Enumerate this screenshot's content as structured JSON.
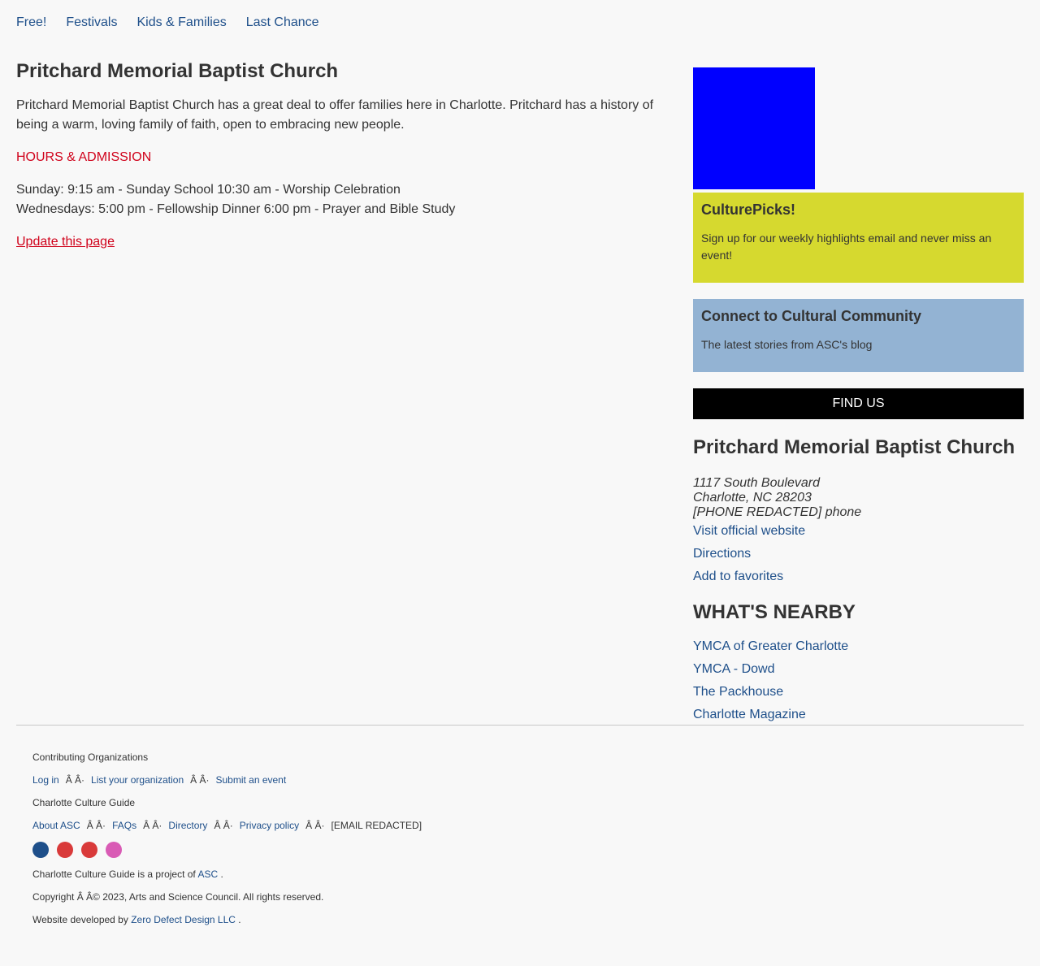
{
  "nav": {
    "items": [
      "Free!",
      "Festivals",
      "Kids & Families",
      "Last Chance"
    ]
  },
  "main": {
    "title": "Pritchard Memorial Baptist Church",
    "intro": "Pritchard Memorial Baptist Church has a great deal to offer families here in Charlotte. Pritchard has a history of being a warm, loving family of faith, open to embracing new people.",
    "hours_title": "HOURS & ADMISSION",
    "hours_lines": [
      "Sunday: 9:15 am - Sunday School 10:30 am - Worship Celebration",
      "Wednesdays: 5:00 pm - Fellowship Dinner 6:00 pm - Prayer and Bible Study"
    ],
    "update_link": "Update this page"
  },
  "sidebar": {
    "culturepicks": {
      "title": "CulturePicks!",
      "text": "Sign up for our weekly highlights email and never miss an event!"
    },
    "connect": {
      "title": "Connect to Cultural Community",
      "text": "The latest stories from ASC's blog"
    },
    "findus_label": "FIND US",
    "venue_title": "Pritchard Memorial Baptist Church",
    "address_lines": [
      "1117 South Boulevard",
      "Charlotte, NC 28203",
      "[PHONE REDACTED] phone"
    ],
    "links": [
      "Visit official website",
      "Directions",
      "Add to favorites"
    ],
    "nearby_title": "WHAT'S NEARBY",
    "nearby": [
      "YMCA of Greater Charlotte",
      "YMCA - Dowd",
      "The Packhouse",
      "Charlotte Magazine"
    ]
  },
  "footer": {
    "contributing": "Contributing Organizations",
    "org_links": [
      "Log in",
      "List your organization",
      "Submit an event"
    ],
    "separator": "Â   Â·",
    "guide_title": "Charlotte Culture Guide",
    "guide_links": [
      "About ASC",
      "FAQs",
      "Directory",
      "Privacy policy"
    ],
    "email": "[EMAIL REDACTED]",
    "social_colors": [
      "#1e4f8a",
      "#d93a3a",
      "#d93a3a",
      "#d95bb5"
    ],
    "project_text": "Charlotte Culture Guide is a project of",
    "project_link": "ASC",
    "period": ".",
    "copyright": "Copyright Â   Â© 2023, Arts and Science Council. All rights reserved.",
    "developed_text": "Website developed by",
    "developer_link": "Zero Defect Design LLC"
  }
}
